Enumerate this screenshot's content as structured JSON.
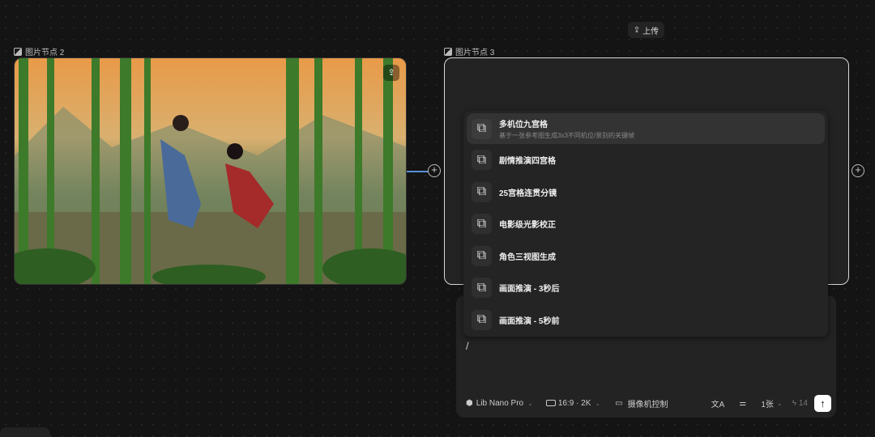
{
  "toolbar": {
    "upload_label": "上传"
  },
  "nodes": [
    {
      "label": "图片节点 2"
    },
    {
      "label": "图片节点 3"
    }
  ],
  "menu": {
    "items": [
      {
        "title": "多机位九宫格",
        "subtitle": "基于一张参考图生成3x3不同机位/景别的关键帧"
      },
      {
        "title": "剧情推演四宫格"
      },
      {
        "title": "25宫格连贯分镜"
      },
      {
        "title": "电影级光影校正"
      },
      {
        "title": "角色三视图生成"
      },
      {
        "title": "画面推演 - 3秒后"
      },
      {
        "title": "画面推演 - 5秒前"
      }
    ]
  },
  "prompt": {
    "value": "/"
  },
  "bottom_bar": {
    "model": "Lib Nano Pro",
    "ratio": "16:9 · 2K",
    "camera": "摄像机控制",
    "count": "1张",
    "credits": "14"
  }
}
